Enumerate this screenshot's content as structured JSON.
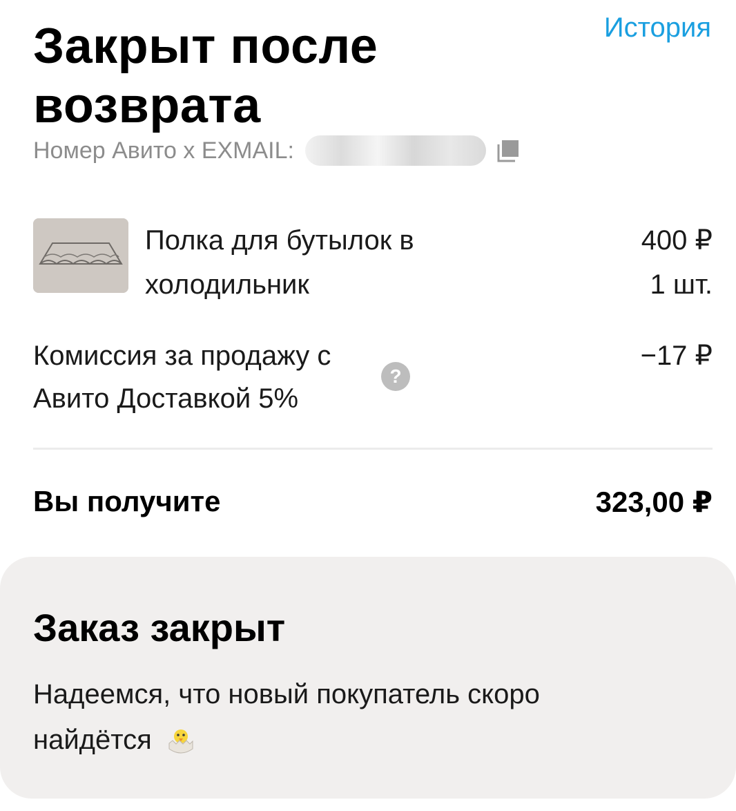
{
  "header": {
    "title": "Закрыт после возврата",
    "history_link": "История"
  },
  "order": {
    "number_label": "Номер Авито x EXMAIL:",
    "icons": {
      "copy": "copy-icon"
    }
  },
  "product": {
    "name": "Полка для бутылок в холодильник",
    "price": "400 ₽",
    "quantity": "1 шт."
  },
  "commission": {
    "label": "Комиссия за продажу с Авито Доставкой 5%",
    "help": "?",
    "value": "−17 ₽"
  },
  "total": {
    "label": "Вы получите",
    "value": "323,00 ₽"
  },
  "status": {
    "title": "Заказ закрыт",
    "text": "Надеемся, что новый покупатель скоро найдётся",
    "icon": "hatching-chick-icon"
  },
  "colors": {
    "accent": "#1a9fe0",
    "muted_text": "#8c8c8c",
    "card_background": "#f1efee"
  }
}
